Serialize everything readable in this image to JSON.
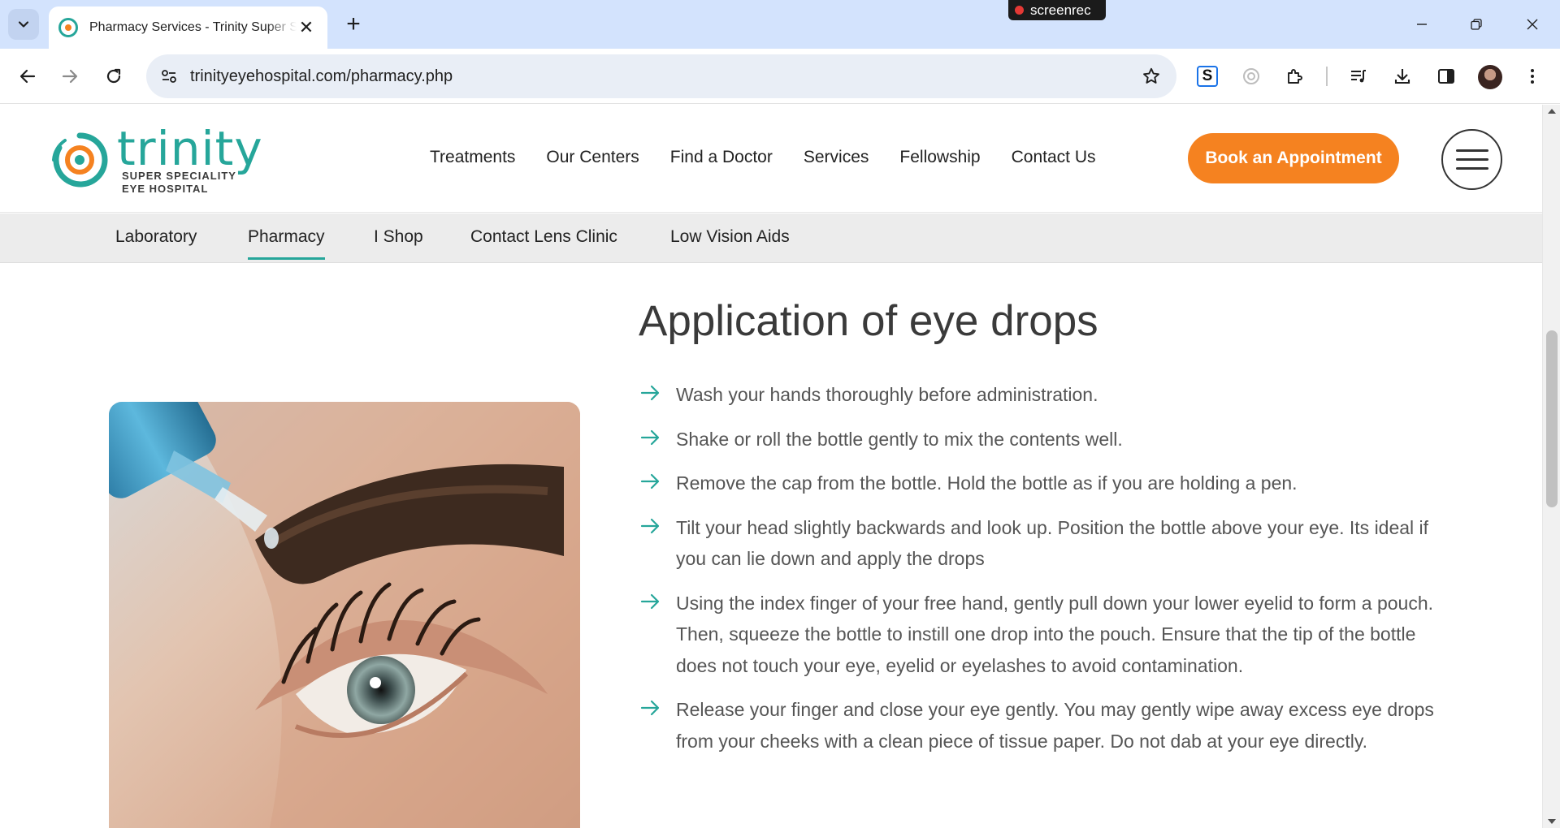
{
  "browser": {
    "tab_title": "Pharmacy Services - Trinity Super Speciality Eye Hospital",
    "url": "trinityeyehospital.com/pharmacy.php",
    "recorder_label": "screenrec",
    "extension_label": "S"
  },
  "site": {
    "logo_word": "trinity",
    "logo_tagline_1": "SUPER SPECIALITY",
    "logo_tagline_2": "EYE HOSPITAL",
    "nav": [
      "Treatments",
      "Our Centers",
      "Find a Doctor",
      "Services",
      "Fellowship",
      "Contact Us"
    ],
    "cta_label": "Book an Appointment",
    "sub_nav": [
      "Laboratory",
      "Pharmacy",
      "I Shop",
      "Contact Lens Clinic",
      "Low Vision Aids"
    ],
    "sub_nav_active": "Pharmacy"
  },
  "content": {
    "title": "Application of eye drops",
    "steps": [
      "Wash your hands thoroughly before administration.",
      "Shake or roll the bottle gently to mix the contents well.",
      "Remove the cap from the bottle. Hold the bottle as if you are holding a pen.",
      "Tilt your head slightly backwards and look up. Position the bottle above your eye. Its ideal if you can lie down and apply the drops",
      "Using the index finger of your free hand, gently pull down your lower eyelid to form a pouch. Then, squeeze the bottle to instill one drop into the pouch. Ensure that the tip of the bottle does not touch your eye, eyelid or eyelashes to avoid contamination.",
      "Release your finger and close your eye gently. You may gently wipe away excess eye drops from your cheeks with a clean piece of tissue paper. Do not dab at your eye directly."
    ]
  },
  "colors": {
    "brand_teal": "#26a69a",
    "brand_orange": "#f58220",
    "tabstrip": "#d3e3fd"
  },
  "icons": {
    "step_bullet": "arrow-right-icon",
    "menu": "hamburger-icon"
  }
}
